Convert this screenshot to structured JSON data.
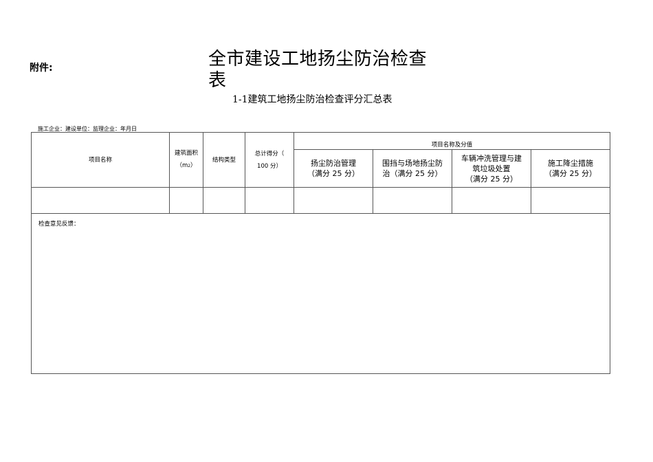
{
  "attachment_label": "附件:",
  "title": "全市建设工地扬尘防治检查表",
  "subtitle": "1-1建筑工地扬尘防治检查评分汇总表",
  "units_line": "施工企业：建设单位：监理企业：年月日",
  "table": {
    "project_name": "项目名称",
    "area_line1": "建筑面积",
    "area_unit": "（m",
    "area_unit_sup": "2",
    "area_unit_close": "）",
    "structure_type": "结构类型",
    "total_score_line1": "总计得分（",
    "total_score_line2": "100 分）",
    "group_header": "项目名称及分值",
    "sub_items": [
      {
        "line1": "扬尘防治管理",
        "line2": "（满分 25 分）"
      },
      {
        "line1": "围挡与场地扬尘防",
        "line2": "治（满分 25 分）"
      },
      {
        "line1": "车辆冲洗管理与建",
        "line2": "筑垃圾处置",
        "line3": "（满分 25 分）"
      },
      {
        "line1": "施工降尘措施",
        "line2": "（满分 25 分）"
      }
    ],
    "feedback_label": "检查意见反馈："
  }
}
